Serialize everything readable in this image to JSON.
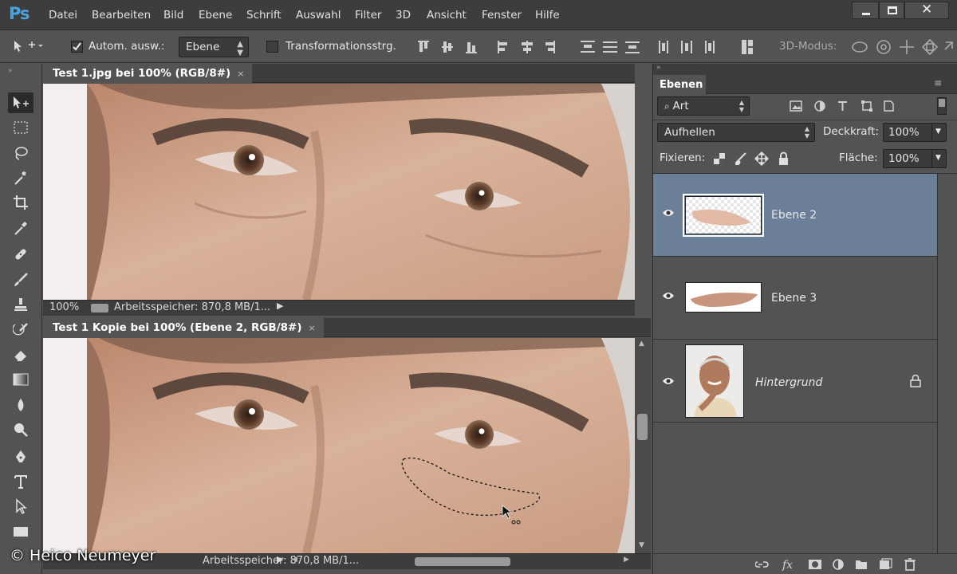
{
  "app": {
    "logo": "Ps"
  },
  "menu": [
    "Datei",
    "Bearbeiten",
    "Bild",
    "Ebene",
    "Schrift",
    "Auswahl",
    "Filter",
    "3D",
    "Ansicht",
    "Fenster",
    "Hilfe"
  ],
  "window_controls": {
    "minimize": "minimize-icon",
    "maximize": "maximize-icon",
    "close": "close-icon"
  },
  "options": {
    "auto_select_label": "Autom. ausw.:",
    "auto_select_checked": true,
    "auto_select_target": "Ebene",
    "transform_label": "Transformationsstrg.",
    "transform_checked": false,
    "mode_3d_label": "3D-Modus:"
  },
  "tools": [
    "move-tool",
    "marquee-tool",
    "lasso-tool",
    "magic-wand-tool",
    "crop-tool",
    "eyedropper-tool",
    "healing-brush-tool",
    "brush-tool",
    "stamp-tool",
    "history-brush-tool",
    "eraser-tool",
    "gradient-tool",
    "blur-tool",
    "dodge-tool",
    "pen-tool",
    "type-tool",
    "path-selection-tool",
    "rectangle-tool"
  ],
  "documents": [
    {
      "tab": "Test 1.jpg bei 100% (RGB/8#)",
      "close": "×",
      "zoom": "100%",
      "memory": "Arbeitsspeicher: 870,8 MB/1..."
    },
    {
      "tab": "Test 1 Kopie bei 100% (Ebene 2, RGB/8#)",
      "close": "×",
      "memory": "Arbeitsspeicher: 870,8 MB/1..."
    }
  ],
  "layers_panel": {
    "title": "Ebenen",
    "filter_label": "Art",
    "blend_mode": "Aufhellen",
    "opacity_label": "Deckkraft:",
    "opacity_value": "100%",
    "lock_label": "Fixieren:",
    "fill_label": "Fläche:",
    "fill_value": "100%",
    "layers": [
      {
        "name": "Ebene 2",
        "selected": true
      },
      {
        "name": "Ebene 3",
        "selected": false
      },
      {
        "name": "Hintergrund",
        "selected": false,
        "locked": true
      }
    ],
    "footer_icons": [
      "link-icon",
      "fx-icon",
      "mask-icon",
      "adjustment-icon",
      "group-folder-icon",
      "new-layer-icon",
      "trash-icon"
    ]
  },
  "watermark": "© Heico Neumeyer"
}
